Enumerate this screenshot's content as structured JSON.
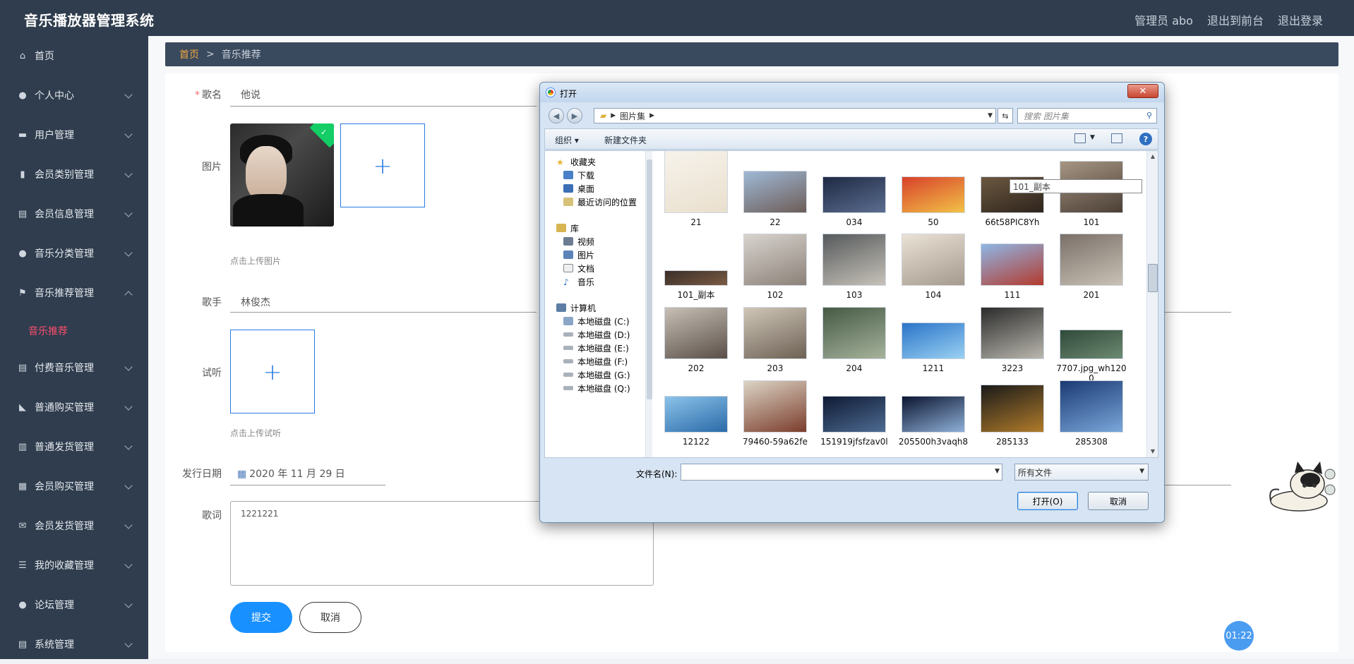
{
  "app": {
    "title": "音乐播放器管理系统",
    "nav": [
      "管理员 abo",
      "退出到前台",
      "退出登录"
    ]
  },
  "sidebar": {
    "items": [
      {
        "label": "首页",
        "icon": "home-icon"
      },
      {
        "label": "个人中心",
        "icon": "user-icon"
      },
      {
        "label": "用户管理",
        "icon": "briefcase-icon"
      },
      {
        "label": "会员类别管理",
        "icon": "bar-chart-icon"
      },
      {
        "label": "会员信息管理",
        "icon": "clipboard-icon"
      },
      {
        "label": "音乐分类管理",
        "icon": "user-icon"
      },
      {
        "label": "音乐推荐管理",
        "icon": "flag-icon"
      },
      {
        "label": "付费音乐管理",
        "icon": "clipboard-icon"
      },
      {
        "label": "普通购买管理",
        "icon": "megaphone-icon"
      },
      {
        "label": "普通发货管理",
        "icon": "columns-icon"
      },
      {
        "label": "会员购买管理",
        "icon": "grid-icon"
      },
      {
        "label": "会员发货管理",
        "icon": "mail-icon"
      },
      {
        "label": "我的收藏管理",
        "icon": "sliders-icon"
      },
      {
        "label": "论坛管理",
        "icon": "pin-icon"
      },
      {
        "label": "系统管理",
        "icon": "clipboard-icon"
      }
    ],
    "active_sub": "音乐推荐"
  },
  "breadcrumb": {
    "home": "首页",
    "sep": ">",
    "current": "音乐推荐"
  },
  "form": {
    "song_label": "歌名",
    "song_value": "他说",
    "image_label": "图片",
    "image_hint": "点击上传图片",
    "singer_label": "歌手",
    "singer_value": "林俊杰",
    "audition_label": "试听",
    "audition_hint": "点击上传试听",
    "date_label": "发行日期",
    "date_value": "2020 年 11 月 29 日",
    "lyrics_label": "歌词",
    "lyrics_value": "1221221",
    "submit": "提交",
    "cancel": "取消"
  },
  "timer": "01:22",
  "dialog": {
    "title": "打开",
    "close": "✕",
    "path": "图片集",
    "search_placeholder": "搜索 图片集",
    "toolbar": {
      "organize": "组织 ▾",
      "new_folder": "新建文件夹"
    },
    "tree": {
      "favorites": "收藏夹",
      "fav_items": [
        "下载",
        "桌面",
        "最近访问的位置"
      ],
      "library": "库",
      "lib_items": [
        "视频",
        "图片",
        "文档",
        "音乐"
      ],
      "computer": "计算机",
      "drives": [
        "本地磁盘 (C:)",
        "本地磁盘 (D:)",
        "本地磁盘 (E:)",
        "本地磁盘 (F:)",
        "本地磁盘 (G:)",
        "本地磁盘 (Q:)"
      ]
    },
    "files": [
      "21",
      "22",
      "034",
      "50",
      "66t58PIC8Yh",
      "101",
      "101_副本",
      "102",
      "103",
      "104",
      "111",
      "201",
      "202",
      "203",
      "204",
      "1211",
      "3223",
      "7707.jpg_wh1200",
      "12122",
      "79460-59a62fe",
      "151919jfsfzav0l",
      "205500h3vaqh8",
      "285133",
      "285308"
    ],
    "tooltip": "101_副本",
    "filename_label": "文件名(N):",
    "filetype": "所有文件",
    "open": "打开(O)",
    "cancel": "取消"
  }
}
